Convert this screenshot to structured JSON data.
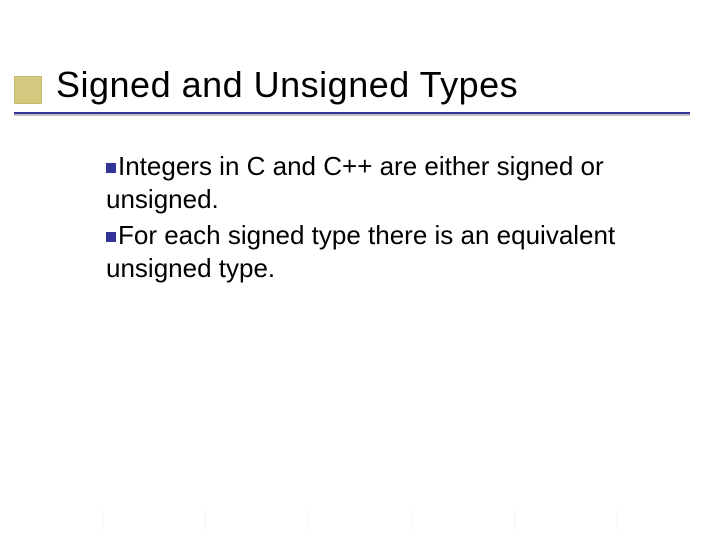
{
  "title": "Signed and Unsigned Types",
  "bullets": [
    "Integers in C and C++ are either signed or unsigned.",
    "For each signed type there is an equivalent unsigned type."
  ],
  "colors": {
    "accent_square": "#d3c97f",
    "rule": "#343399",
    "bullet": "#343399"
  }
}
